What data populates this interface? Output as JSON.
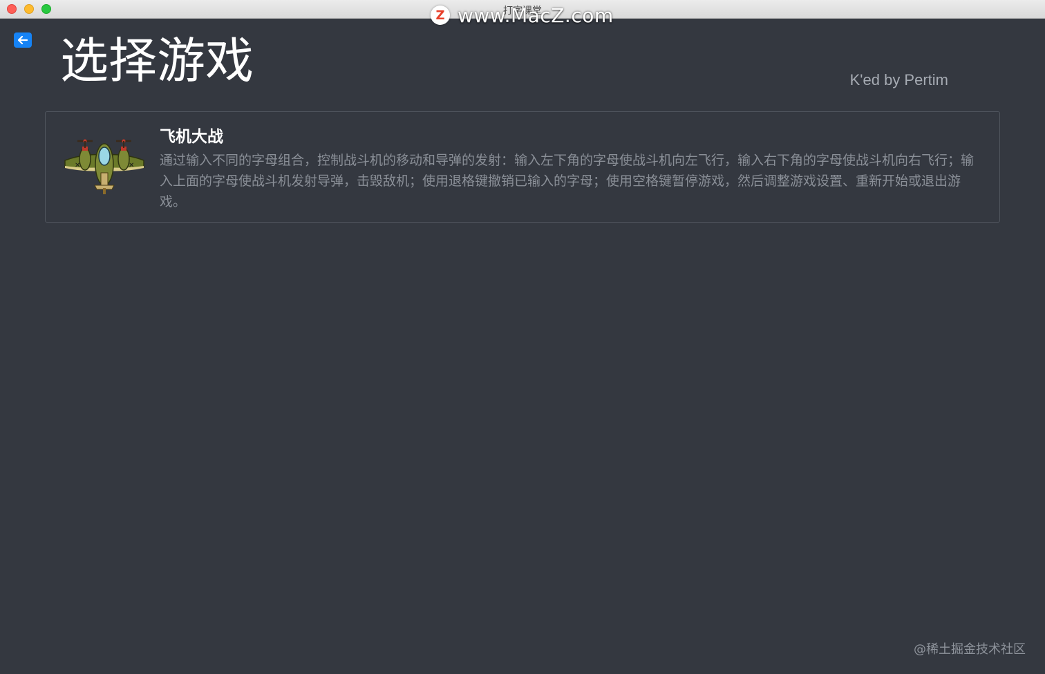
{
  "window": {
    "title": "打字课堂",
    "watermark_logo": "Z",
    "watermark_text": "www.MacZ.com"
  },
  "header": {
    "back_icon": "arrow-left-icon",
    "title": "选择游戏",
    "credit": "K'ed by Pertim"
  },
  "games": [
    {
      "icon": "airplane-icon",
      "name": "飞机大战",
      "description": "通过输入不同的字母组合，控制战斗机的移动和导弹的发射：输入左下角的字母使战斗机向左飞行，输入右下角的字母使战斗机向右飞行；输入上面的字母使战斗机发射导弹，击毁敌机；使用退格键撤销已输入的字母；使用空格键暂停游戏，然后调整游戏设置、重新开始或退出游戏。"
    }
  ],
  "footer": {
    "watermark": "@稀土掘金技术社区"
  },
  "colors": {
    "background": "#343840",
    "accent": "#1683f5",
    "card_border": "#50555e",
    "description": "#8a8f97"
  }
}
